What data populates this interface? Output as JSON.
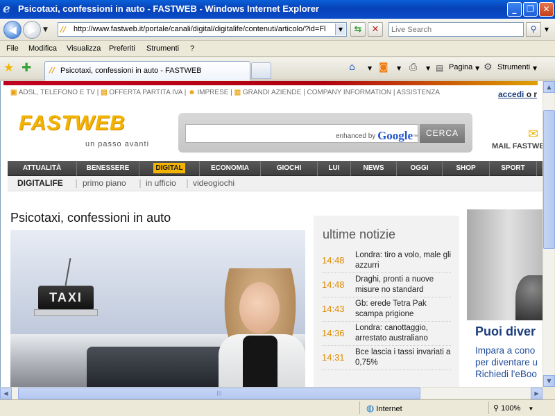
{
  "window": {
    "title": "Psicotaxi, confessioni in auto - FASTWEB - Windows Internet Explorer",
    "min_glyph": "_",
    "max_glyph": "❐",
    "close_glyph": "✕"
  },
  "navbar": {
    "back_glyph": "◀",
    "forward_glyph": "▶",
    "dropdown_glyph": "▼",
    "url": "http://www.fastweb.it/portale/canali/digital/digitalife/contenuti/articolo/?id=Fl",
    "search_placeholder": "Live Search"
  },
  "menubar": {
    "items": [
      "File",
      "Modifica",
      "Visualizza",
      "Preferiti",
      "Strumenti",
      "?"
    ]
  },
  "tabs": {
    "active_label": "Psicotaxi, confessioni in auto - FASTWEB"
  },
  "commandbar": {
    "pagina_label": "Pagina",
    "strumenti_label": "Strumenti"
  },
  "page": {
    "toplinks": {
      "adsl": "ADSL, TELEFONO E TV",
      "partita_iva": "OFFERTA PARTITA IVA",
      "imprese": "IMPRESE",
      "grandi_aziende": "GRANDI AZIENDE",
      "company": "COMPANY INFORMATION",
      "assistenza": "ASSISTENZA"
    },
    "login": {
      "accedi": "accedi",
      "o": "o r"
    },
    "logo": "FASTWEB",
    "slogan": "un passo avanti",
    "search": {
      "enhanced_by": "enhanced by",
      "google": "Google",
      "tm": "™",
      "button": "CERCA"
    },
    "mail_label": "MAIL FASTWE",
    "categories": [
      "ATTUALITÀ",
      "BENESSERE",
      "DIGITAL",
      "ECONOMIA",
      "GIOCHI",
      "LUI",
      "NEWS",
      "OGGI",
      "SHOP",
      "SPORT"
    ],
    "subnav": {
      "main": "DIGITALIFE",
      "items": [
        "primo piano",
        "in ufficio",
        "videogiochi"
      ],
      "separator": "|"
    },
    "article_title": "Psicotaxi, confessioni in auto",
    "photo_sign": "TAXI",
    "news": {
      "heading": "ultime notizie",
      "items": [
        {
          "time": "14:48",
          "text": "Londra: tiro a volo, male gli azzurri"
        },
        {
          "time": "14:48",
          "text": "Draghi, pronti a nuove misure no standard"
        },
        {
          "time": "14:43",
          "text": "Gb: erede Tetra Pak scampa prigione"
        },
        {
          "time": "14:36",
          "text": "Londra: canottaggio, arrestato australiano"
        },
        {
          "time": "14:31",
          "text": "Bce lascia i tassi invariati a 0,75%"
        }
      ]
    },
    "promo": {
      "headline": "Puoi diver",
      "line1": "Impara a cono",
      "line2": "per diventare u",
      "line3": "Richiedi l'eBoo"
    }
  },
  "status": {
    "zone": "Internet",
    "zoom": "100%"
  }
}
